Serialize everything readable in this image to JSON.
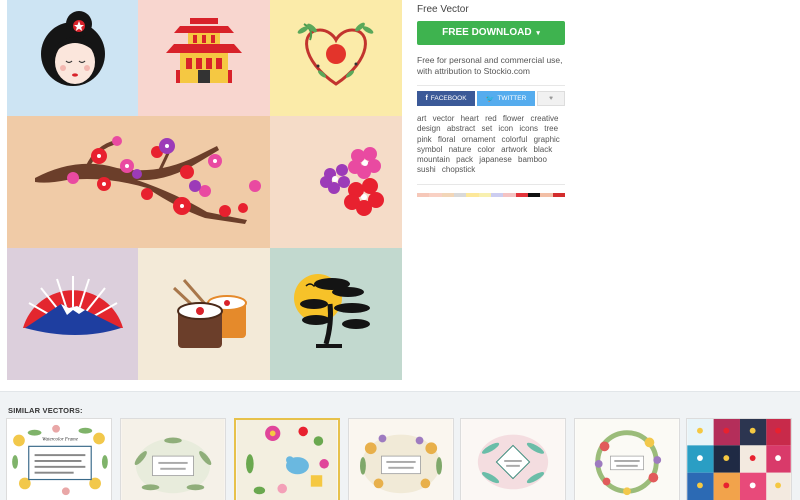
{
  "panel": {
    "license_type": "Free Vector",
    "download_label": "FREE DOWNLOAD",
    "download_caret": "▾",
    "license_text": "Free for personal and commercial use, with attribution to Stockio.com",
    "share": {
      "facebook_label": "FACEBOOK",
      "facebook_icon": "f",
      "twitter_label": "TWITTER",
      "twitter_icon": "🐦",
      "favorite_icon": "♥"
    },
    "tags": [
      "art",
      "vector",
      "heart",
      "red",
      "flower",
      "creative",
      "design",
      "abstract",
      "set",
      "icon",
      "icons",
      "tree",
      "pink",
      "floral",
      "ornament",
      "colorful",
      "graphic",
      "symbol",
      "nature",
      "color",
      "artwork",
      "black",
      "mountain",
      "pack",
      "japanese",
      "bamboo",
      "sushi",
      "chopstick"
    ],
    "palette": [
      "#f6c8b9",
      "#f9d1c4",
      "#f2d6b8",
      "#d9d9d9",
      "#fde89a",
      "#f8f0b0",
      "#cccdf0",
      "#f4c3c3",
      "#e3343b",
      "#111111",
      "#f2bfa6",
      "#d32d2d"
    ]
  },
  "similar": {
    "title": "SIMILAR VECTORS:",
    "thumb1_heading": "Watercolor Frame"
  }
}
